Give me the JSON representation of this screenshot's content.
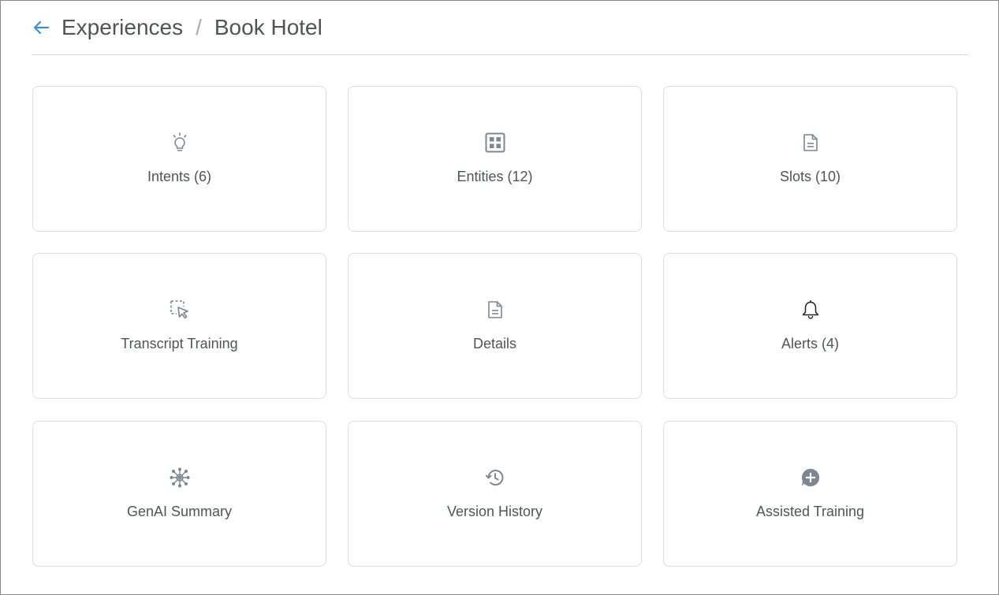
{
  "header": {
    "breadcrumb_parent": "Experiences",
    "separator": "/",
    "current": "Book Hotel"
  },
  "accent_color": "#3b8fd6",
  "icon_color": "#7c8791",
  "cards": [
    {
      "label": "Intents (6)",
      "icon": "lightbulb-icon"
    },
    {
      "label": "Entities (12)",
      "icon": "grid-box-icon"
    },
    {
      "label": "Slots (10)",
      "icon": "document-icon"
    },
    {
      "label": "Transcript Training",
      "icon": "cursor-selection-icon"
    },
    {
      "label": "Details",
      "icon": "document-icon"
    },
    {
      "label": "Alerts (4)",
      "icon": "bell-icon"
    },
    {
      "label": "GenAI Summary",
      "icon": "network-icon"
    },
    {
      "label": "Version History",
      "icon": "history-icon"
    },
    {
      "label": "Assisted Training",
      "icon": "chat-plus-icon"
    }
  ]
}
